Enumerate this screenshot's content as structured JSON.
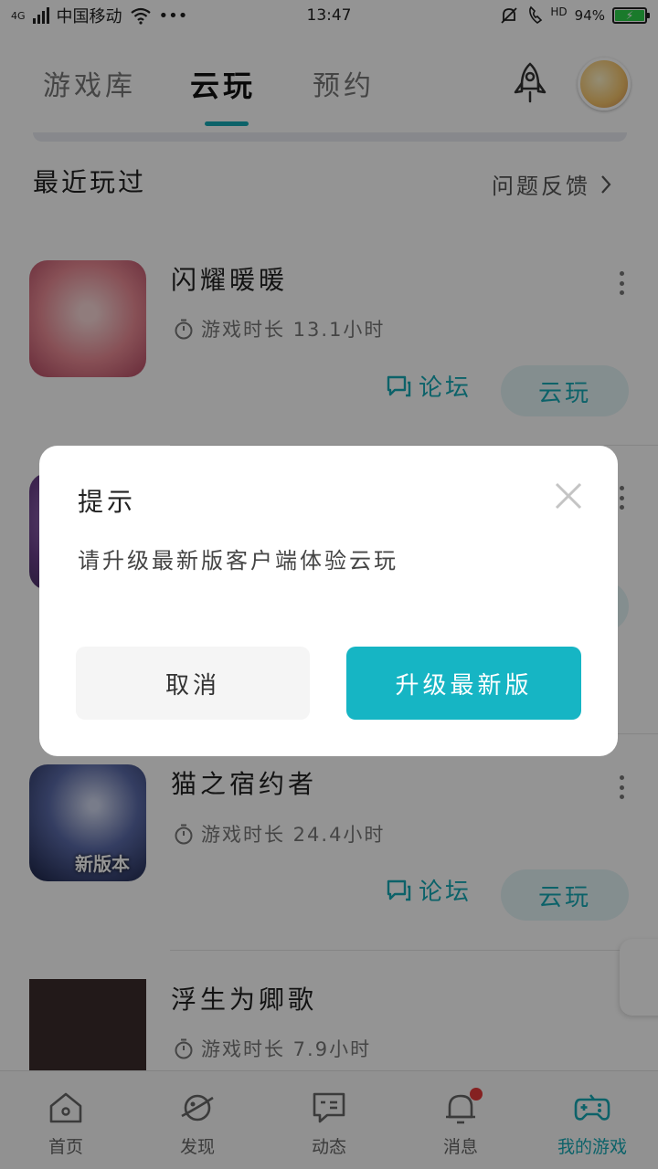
{
  "status_bar": {
    "network": "4G",
    "carrier": "中国移动",
    "more": "•••",
    "time": "13:47",
    "hd": "HD",
    "battery_percent": "94%"
  },
  "tabs": [
    {
      "label": "游戏库",
      "active": false
    },
    {
      "label": "云玩",
      "active": true
    },
    {
      "label": "预约",
      "active": false
    }
  ],
  "section": {
    "title": "最近玩过",
    "feedback_label": "问题反馈"
  },
  "games": [
    {
      "name": "闪耀暖暖",
      "time": "游戏时长 13.1小时",
      "forum": "论坛",
      "play": "云玩",
      "cover_colors": [
        "#f8d6d6",
        "#e98a94",
        "#b44a63"
      ]
    },
    {
      "name": "",
      "time": "",
      "forum": "",
      "play": "",
      "cover_colors": [
        "#6a3f8a",
        "#b48ad6",
        "#3a2a56"
      ]
    },
    {
      "name": "猫之宿约者",
      "time": "游戏时长 24.4小时",
      "forum": "论坛",
      "play": "云玩",
      "cover_label": "新版本",
      "cover_colors": [
        "#cfd6ee",
        "#5a6aa8",
        "#1b2346"
      ]
    },
    {
      "name": "浮生为卿歌",
      "time": "游戏时长 7.9小时",
      "cover_colors": [
        "#3b2b2b",
        "#3b2b2b",
        "#3b2b2b"
      ]
    }
  ],
  "dialog": {
    "title": "提示",
    "message": "请升级最新版客户端体验云玩",
    "cancel": "取消",
    "confirm": "升级最新版"
  },
  "bottom_nav": [
    {
      "label": "首页",
      "icon": "home-icon",
      "active": false
    },
    {
      "label": "发现",
      "icon": "planet-icon",
      "active": false
    },
    {
      "label": "动态",
      "icon": "message-icon",
      "active": false
    },
    {
      "label": "消息",
      "icon": "bell-icon",
      "active": false,
      "badge": true
    },
    {
      "label": "我的游戏",
      "icon": "gamepad-icon",
      "active": true
    }
  ],
  "colors": {
    "accent": "#16b5c4",
    "accent_light": "#e4f5f6",
    "overlay": "rgba(0,0,0,0.42)"
  }
}
